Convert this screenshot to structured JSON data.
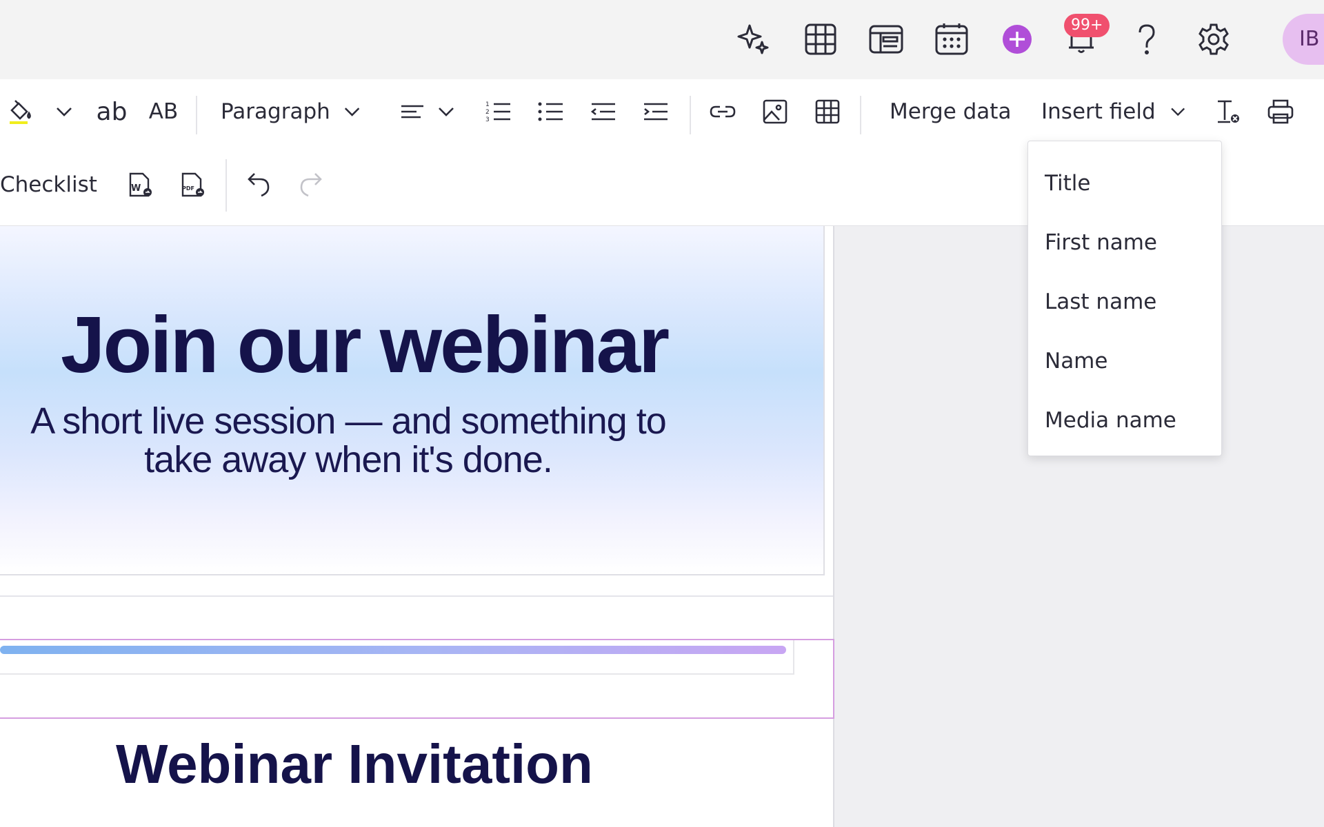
{
  "topbar": {
    "icons": {
      "sparkle": "sparkle-icon",
      "grid": "grid-icon",
      "kanban": "board-icon",
      "calendar": "calendar-icon",
      "add": "plus-circle-icon",
      "bell": "bell-icon",
      "help": "help-icon",
      "settings": "gear-icon"
    },
    "notification_count": "99+",
    "avatar_initials": "IB",
    "accent_color": "#b04ed8",
    "badge_color": "#f0506e"
  },
  "toolbar": {
    "paragraph_label": "Paragraph",
    "merge_data_label": "Merge data",
    "insert_field_label": "Insert field",
    "checklist_label": "Checklist",
    "lowercase_label": "ab",
    "uppercase_label": "AB"
  },
  "dropdown": {
    "items": [
      "Title",
      "First name",
      "Last name",
      "Name",
      "Media name"
    ]
  },
  "document": {
    "hero_title": "Join our webinar",
    "hero_subtitle_line1": "A short live session — and something to",
    "hero_subtitle_line2": "take away when it's done.",
    "heading": "Webinar Invitation",
    "title_color": "#15134a"
  }
}
